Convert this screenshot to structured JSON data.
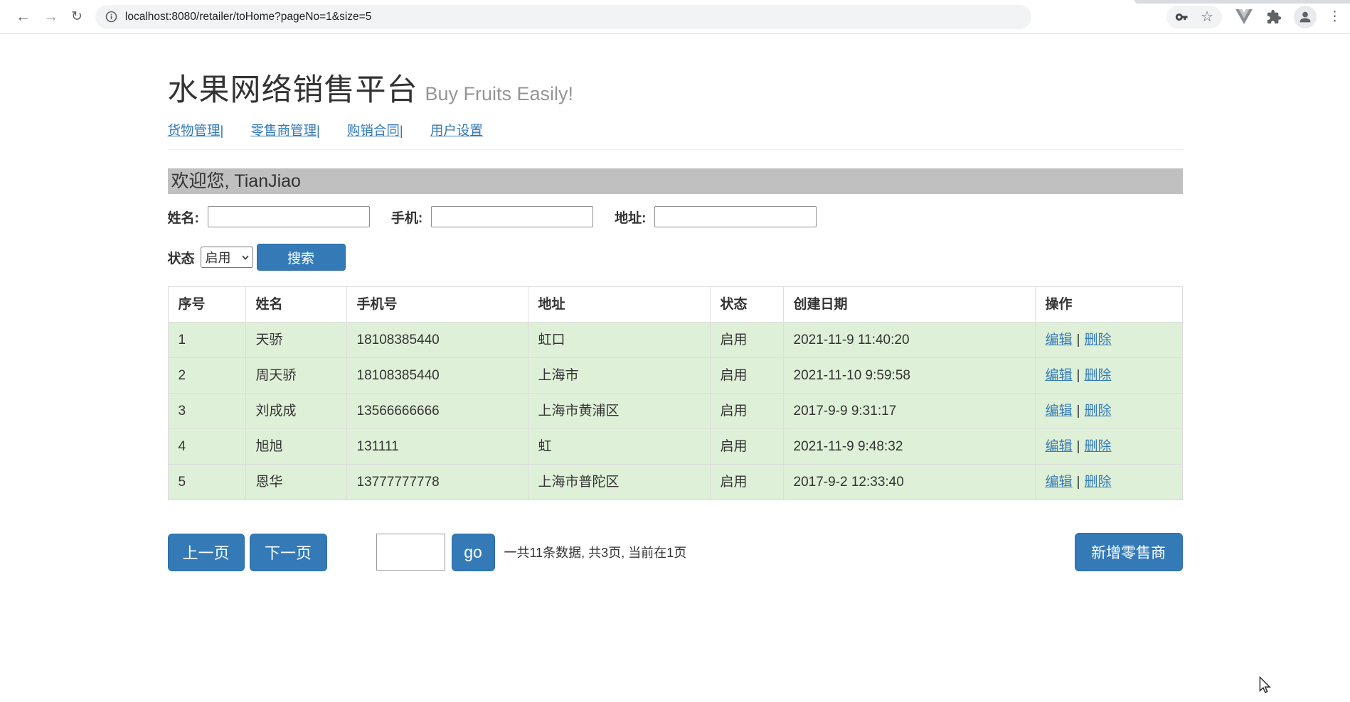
{
  "browser": {
    "url": "localhost:8080/retailer/toHome?pageNo=1&size=5",
    "icons": {
      "back": "←",
      "forward": "→",
      "reload": "↻",
      "star": "☆",
      "menu_dots": "⋮"
    }
  },
  "header": {
    "title": "水果网络销售平台",
    "subtitle": "Buy Fruits Easily!",
    "nav": [
      {
        "label": "货物管理|"
      },
      {
        "label": "零售商管理|"
      },
      {
        "label": "购销合同|"
      },
      {
        "label": "用户设置"
      }
    ]
  },
  "welcome": {
    "text": "欢迎您, TianJiao"
  },
  "search": {
    "name_label": "姓名:",
    "phone_label": "手机:",
    "address_label": "地址:",
    "name_value": "",
    "phone_value": "",
    "address_value": "",
    "status_label": "状态",
    "status_value": "启用",
    "search_button": "搜索"
  },
  "table": {
    "headers": [
      "序号",
      "姓名",
      "手机号",
      "地址",
      "状态",
      "创建日期",
      "操作"
    ],
    "edit_label": "编辑",
    "separator": "|",
    "delete_label": "删除",
    "rows": [
      {
        "no": "1",
        "name": "天骄",
        "phone": "18108385440",
        "address": "虹口",
        "status": "启用",
        "created": "2021-11-9 11:40:20"
      },
      {
        "no": "2",
        "name": "周天骄",
        "phone": "18108385440",
        "address": "上海市",
        "status": "启用",
        "created": "2021-11-10 9:59:58"
      },
      {
        "no": "3",
        "name": "刘成成",
        "phone": "13566666666",
        "address": "上海市黄浦区",
        "status": "启用",
        "created": "2017-9-9 9:31:17"
      },
      {
        "no": "4",
        "name": "旭旭",
        "phone": "131111",
        "address": "虹",
        "status": "启用",
        "created": "2021-11-9 9:48:32"
      },
      {
        "no": "5",
        "name": "恩华",
        "phone": "13777777778",
        "address": "上海市普陀区",
        "status": "启用",
        "created": "2017-9-2 12:33:40"
      }
    ]
  },
  "pagination": {
    "prev_button": "上一页",
    "next_button": "下一页",
    "page_input_value": "",
    "go_button": "go",
    "info": "一共11条数据, 共3页, 当前在1页",
    "add_retailer_button": "新增零售商"
  },
  "colors": {
    "primary_blue": "#337ab7",
    "row_green": "#dff0d8",
    "welcome_gray": "#c0c0c0",
    "link_blue": "#337ab7"
  }
}
